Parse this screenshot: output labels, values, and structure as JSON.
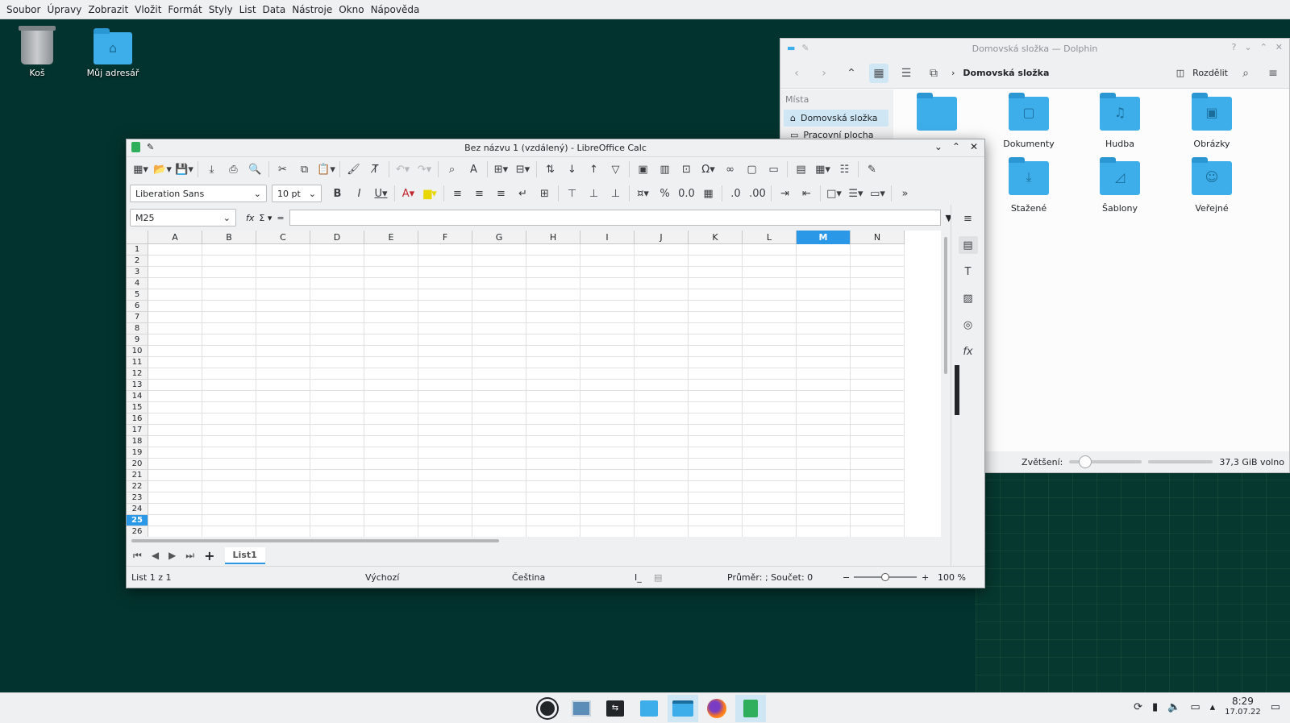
{
  "global_menu": [
    "Soubor",
    "Úpravy",
    "Zobrazit",
    "Vložit",
    "Formát",
    "Styly",
    "List",
    "Data",
    "Nástroje",
    "Okno",
    "Nápověda"
  ],
  "desktop": {
    "icons": [
      {
        "label": "Koš"
      },
      {
        "label": "Můj adresář"
      }
    ]
  },
  "dolphin": {
    "title": "Domovská složka — Dolphin",
    "breadcrumb": "Domovská složka",
    "split_label": "Rozdělit",
    "places_header": "Místa",
    "places": [
      "Domovská složka",
      "Pracovní plocha"
    ],
    "folders": [
      "Dokumenty",
      "Hudba",
      "Obrázky",
      "Stažené",
      "Šablony",
      "Veřejné"
    ],
    "zoom_label": "Zvětšení:",
    "free_space": "37,3 GiB volno"
  },
  "calc": {
    "title": "Bez názvu 1 (vzdálený) - LibreOffice Calc",
    "font_name": "Liberation Sans",
    "font_size": "10 pt",
    "name_box": "M25",
    "formula_eq": "=",
    "columns": [
      "A",
      "B",
      "C",
      "D",
      "E",
      "F",
      "G",
      "H",
      "I",
      "J",
      "K",
      "L",
      "M",
      "N"
    ],
    "selected_column": "M",
    "rows": [
      "1",
      "2",
      "3",
      "4",
      "5",
      "6",
      "7",
      "8",
      "9",
      "10",
      "11",
      "12",
      "13",
      "14",
      "15",
      "16",
      "17",
      "18",
      "19",
      "20",
      "21",
      "22",
      "23",
      "24",
      "25",
      "26"
    ],
    "selected_row": "25",
    "sheet_tab": "List1",
    "status": {
      "sheet": "List 1 z 1",
      "style": "Výchozí",
      "language": "Čeština",
      "summary": "Průměr: ; Součet: 0",
      "zoom": "100 %"
    }
  },
  "taskbar": {
    "time": "8:29",
    "date": "17.07.22"
  },
  "colors": {
    "accent": "#2a98e6",
    "desktop": "#03332e",
    "folder": "#3daee9",
    "calc_green": "#2fae5b"
  }
}
